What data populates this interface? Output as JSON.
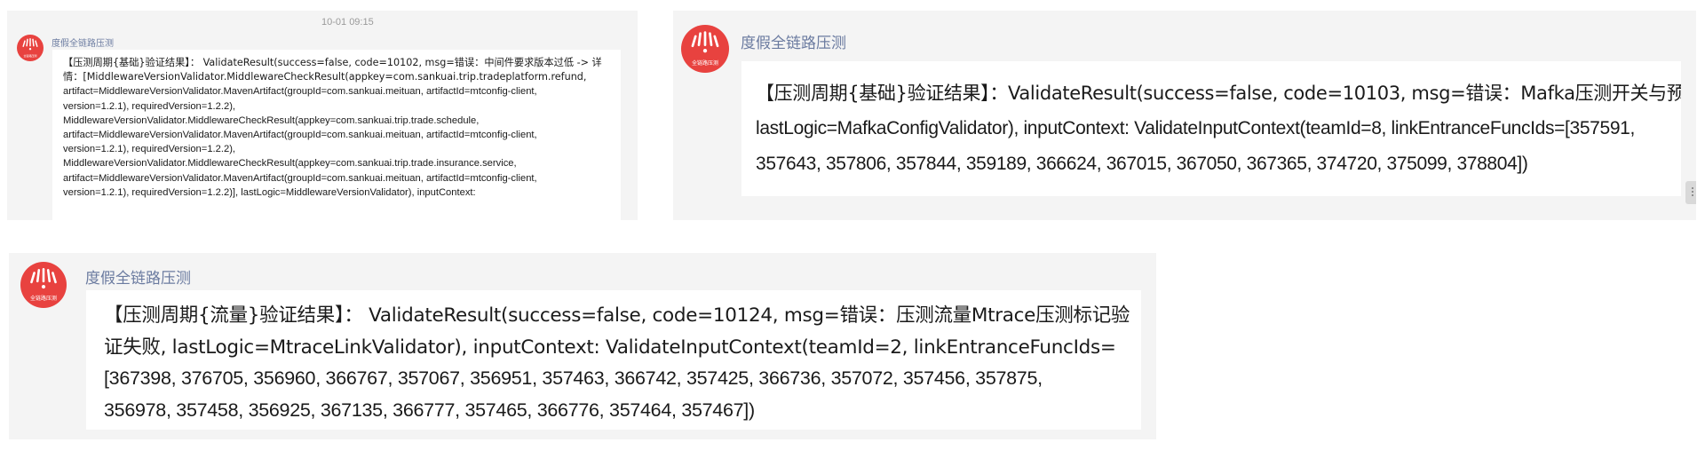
{
  "panel_top_left": {
    "timestamp": "10-01 09:15",
    "sender": "度假全链路压测",
    "message_lines": [
      "【压测周期{基础}验证结果】： ValidateResult(success=false, code=10102, msg=错误：中间件要求版本过低 -> 详",
      "情：[MiddlewareVersionValidator.MiddlewareCheckResult(appkey=com.sankuai.trip.tradeplatform.refund,",
      "artifact=MiddlewareVersionValidator.MavenArtifact(groupId=com.sankuai.meituan, artifactId=mtconfig-client,",
      "version=1.2.1), requiredVersion=1.2.2),",
      "MiddlewareVersionValidator.MiddlewareCheckResult(appkey=com.sankuai.trip.trade.schedule,",
      "artifact=MiddlewareVersionValidator.MavenArtifact(groupId=com.sankuai.meituan, artifactId=mtconfig-client,",
      "version=1.2.1), requiredVersion=1.2.2),",
      "MiddlewareVersionValidator.MiddlewareCheckResult(appkey=com.sankuai.trip.trade.insurance.service,",
      "artifact=MiddlewareVersionValidator.MavenArtifact(groupId=com.sankuai.meituan, artifactId=mtconfig-client,",
      "version=1.2.1), requiredVersion=1.2.2)], lastLogic=MiddlewareVersionValidator), inputContext:"
    ]
  },
  "panel_top_right": {
    "sender": "度假全链路压测",
    "message_lines": [
      "【压测周期{基础}验证结果】：ValidateResult(success=false, code=10103, msg=错误：Mafka压测开关与预期不符,",
      "lastLogic=MafkaConfigValidator), inputContext: ValidateInputContext(teamId=8, linkEntranceFuncIds=[357591,",
      "357643, 357806, 357844, 359189, 366624, 367015, 367050, 367365, 374720, 375099, 378804])"
    ]
  },
  "panel_bottom": {
    "sender": "度假全链路压测",
    "message_lines": [
      "【压测周期{流量}验证结果】： ValidateResult(success=false, code=10124, msg=错误：压测流量Mtrace压测标记验",
      "证失败, lastLogic=MtraceLinkValidator), inputContext: ValidateInputContext(teamId=2, linkEntranceFuncIds=",
      "[367398, 376705, 356960, 366767, 357067, 356951, 357463, 366742, 357425, 366736, 357072, 357456, 357875,",
      "356978, 357458, 356925, 367135, 366777, 357465, 366776, 357464, 357467])"
    ]
  },
  "avatar": {
    "label": "全链路压测",
    "icon": "fruit-logo-icon",
    "color": "#e8423f"
  },
  "colors": {
    "panel_background": "#f4f4f4",
    "bubble_background": "#ffffff",
    "sender_name": "#6b7ba0",
    "timestamp": "#9a9a9a"
  }
}
